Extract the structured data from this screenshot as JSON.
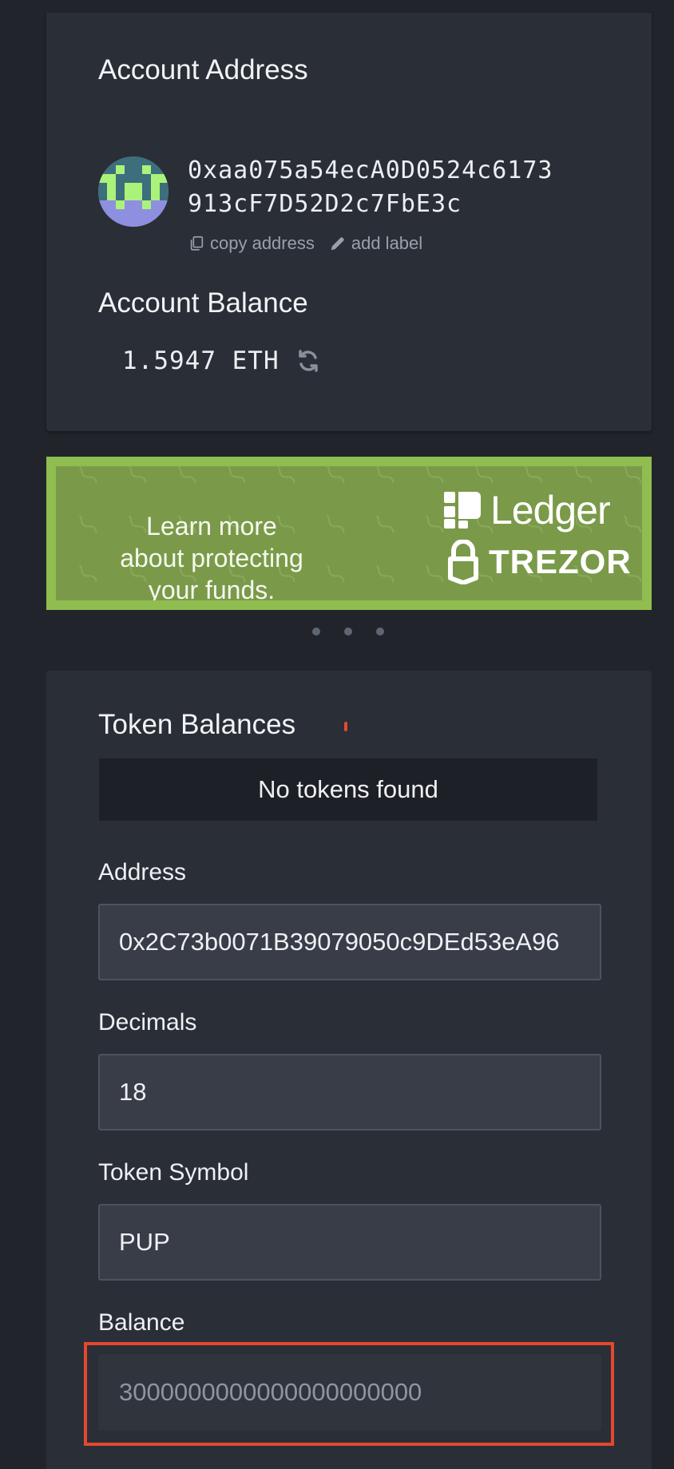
{
  "account": {
    "heading": "Account Address",
    "address_line1": "0xaa075a54ecA0D0524c6173",
    "address_line2": "913cF7D52D2c7FbE3c",
    "copy_label": "copy address",
    "label_label": "add label",
    "balance_heading": "Account Balance",
    "balance_value": "1.5947 ETH"
  },
  "promo": {
    "text": "Learn more about protecting your funds.",
    "brand1": "Ledger",
    "brand2": "TREZOR",
    "banner_color": "#7a9a49"
  },
  "carousel": {
    "dot_count": 3
  },
  "tokens": {
    "heading": "Token Balances",
    "empty_message": "No tokens found",
    "address_label": "Address",
    "address_value": "0x2C73b0071B39079050c9DEd53eA96",
    "decimals_label": "Decimals",
    "decimals_value": "18",
    "symbol_label": "Token Symbol",
    "symbol_value": "PUP",
    "balance_label": "Balance",
    "balance_value": "3000000000000000000000"
  },
  "colors": {
    "background": "#21252b",
    "panel": "#2a2e36",
    "highlight": "#e5472f",
    "identicon": [
      "#8f8fe0",
      "#aaf27a",
      "#3d6e7c"
    ]
  },
  "icons": [
    "copy-icon",
    "pencil-icon",
    "refresh-icon",
    "ledger-logo-icon",
    "trezor-lock-icon"
  ]
}
